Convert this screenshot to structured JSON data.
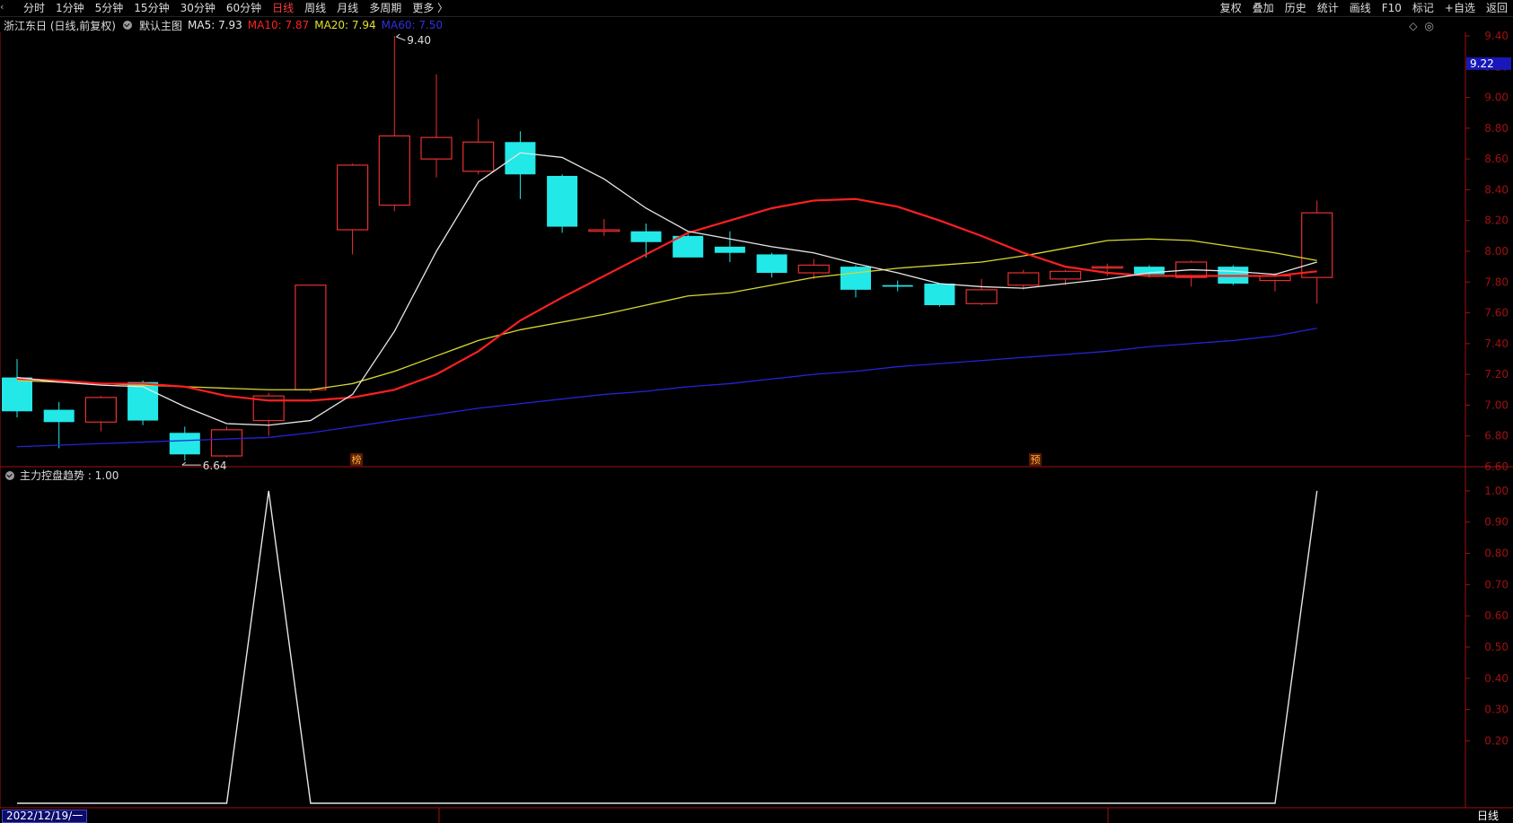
{
  "toolbar": {
    "left": [
      "分时",
      "1分钟",
      "5分钟",
      "15分钟",
      "30分钟",
      "60分钟",
      "日线",
      "周线",
      "月线",
      "多周期",
      "更多 〉"
    ],
    "active": "日线",
    "right": [
      "复权",
      "叠加",
      "历史",
      "统计",
      "画线",
      "F10",
      "标记",
      "+自选",
      "返回"
    ]
  },
  "info": {
    "stock": "浙江东日 (日线,前复权)",
    "chart_name": "默认主图",
    "ma5": "MA5: 7.93",
    "ma10": "MA10: 7.87",
    "ma20": "MA20: 7.94",
    "ma60": "MA60: 7.50"
  },
  "corner": [
    "◇",
    "◎"
  ],
  "indicator_label": "主力控盘趋势 : 1.00",
  "date_label": "2022/12/19/一",
  "period_label": "日线",
  "colors": {
    "up": "#e83030",
    "down": "#22e8e8",
    "ma5": "#e6e6e6",
    "ma10": "#ff2020",
    "ma20": "#d8d830",
    "ma60": "#2424d8",
    "axis": "#a01010",
    "bg": "#000000"
  },
  "chart_data": [
    {
      "type": "candlestick",
      "ylim": [
        6.6,
        9.4
      ],
      "yticks": [
        "9.40",
        "9.20",
        "9.00",
        "8.80",
        "8.60",
        "8.40",
        "8.20",
        "8.00",
        "7.80",
        "7.60",
        "7.40",
        "7.20",
        "7.00",
        "6.80",
        "6.60"
      ],
      "last_price": "9.22",
      "max_label": "9.40",
      "min_label": "6.64",
      "markers": [
        "榜",
        "预"
      ],
      "candles": [
        {
          "o": 7.18,
          "h": 7.3,
          "l": 6.92,
          "c": 6.96
        },
        {
          "o": 6.97,
          "h": 7.02,
          "l": 6.72,
          "c": 6.89
        },
        {
          "o": 6.89,
          "h": 7.06,
          "l": 6.83,
          "c": 7.05
        },
        {
          "o": 7.15,
          "h": 7.16,
          "l": 6.87,
          "c": 6.9
        },
        {
          "o": 6.82,
          "h": 6.86,
          "l": 6.64,
          "c": 6.68
        },
        {
          "o": 6.67,
          "h": 6.86,
          "l": 6.66,
          "c": 6.84
        },
        {
          "o": 6.9,
          "h": 7.08,
          "l": 6.8,
          "c": 7.06
        },
        {
          "o": 7.1,
          "h": 7.78,
          "l": 7.08,
          "c": 7.78
        },
        {
          "o": 8.14,
          "h": 8.57,
          "l": 7.98,
          "c": 8.56
        },
        {
          "o": 8.3,
          "h": 9.4,
          "l": 8.26,
          "c": 8.75
        },
        {
          "o": 8.6,
          "h": 9.15,
          "l": 8.48,
          "c": 8.74
        },
        {
          "o": 8.52,
          "h": 8.86,
          "l": 8.5,
          "c": 8.71
        },
        {
          "o": 8.71,
          "h": 8.78,
          "l": 8.34,
          "c": 8.5
        },
        {
          "o": 8.49,
          "h": 8.5,
          "l": 8.12,
          "c": 8.16
        },
        {
          "o": 8.13,
          "h": 8.21,
          "l": 8.1,
          "c": 8.14
        },
        {
          "o": 8.13,
          "h": 8.18,
          "l": 7.96,
          "c": 8.06
        },
        {
          "o": 8.1,
          "h": 8.12,
          "l": 7.96,
          "c": 7.96
        },
        {
          "o": 8.03,
          "h": 8.13,
          "l": 7.93,
          "c": 7.99
        },
        {
          "o": 7.98,
          "h": 7.99,
          "l": 7.83,
          "c": 7.86
        },
        {
          "o": 7.86,
          "h": 7.95,
          "l": 7.82,
          "c": 7.91
        },
        {
          "o": 7.9,
          "h": 7.91,
          "l": 7.7,
          "c": 7.75
        },
        {
          "o": 7.78,
          "h": 7.81,
          "l": 7.74,
          "c": 7.77
        },
        {
          "o": 7.79,
          "h": 7.79,
          "l": 7.64,
          "c": 7.65
        },
        {
          "o": 7.66,
          "h": 7.82,
          "l": 7.65,
          "c": 7.75
        },
        {
          "o": 7.78,
          "h": 7.88,
          "l": 7.75,
          "c": 7.86
        },
        {
          "o": 7.82,
          "h": 7.88,
          "l": 7.78,
          "c": 7.87
        },
        {
          "o": 7.9,
          "h": 7.92,
          "l": 7.84,
          "c": 7.9
        },
        {
          "o": 7.9,
          "h": 7.91,
          "l": 7.83,
          "c": 7.85
        },
        {
          "o": 7.83,
          "h": 7.94,
          "l": 7.77,
          "c": 7.93
        },
        {
          "o": 7.9,
          "h": 7.91,
          "l": 7.78,
          "c": 7.79
        },
        {
          "o": 7.81,
          "h": 7.86,
          "l": 7.74,
          "c": 7.84
        },
        {
          "o": 7.83,
          "h": 8.33,
          "l": 7.66,
          "c": 8.25
        }
      ],
      "ma5": [
        7.18,
        7.15,
        7.13,
        7.12,
        6.99,
        6.88,
        6.87,
        6.9,
        7.07,
        7.48,
        8.0,
        8.45,
        8.64,
        8.61,
        8.47,
        8.28,
        8.13,
        8.08,
        8.03,
        7.99,
        7.92,
        7.86,
        7.79,
        7.77,
        7.76,
        7.79,
        7.82,
        7.86,
        7.88,
        7.87,
        7.85,
        7.93
      ],
      "ma10": [
        7.17,
        7.16,
        7.14,
        7.14,
        7.12,
        7.06,
        7.03,
        7.03,
        7.05,
        7.1,
        7.2,
        7.35,
        7.55,
        7.7,
        7.84,
        7.98,
        8.12,
        8.2,
        8.28,
        8.33,
        8.34,
        8.29,
        8.2,
        8.1,
        7.99,
        7.9,
        7.86,
        7.84,
        7.84,
        7.84,
        7.84,
        7.87
      ],
      "ma20": [
        7.16,
        7.15,
        7.14,
        7.13,
        7.12,
        7.11,
        7.1,
        7.1,
        7.14,
        7.22,
        7.32,
        7.42,
        7.49,
        7.54,
        7.59,
        7.65,
        7.71,
        7.73,
        7.78,
        7.83,
        7.86,
        7.89,
        7.91,
        7.93,
        7.97,
        8.02,
        8.07,
        8.08,
        8.07,
        8.03,
        7.99,
        7.94
      ],
      "ma60": [
        6.73,
        6.74,
        6.75,
        6.76,
        6.77,
        6.78,
        6.79,
        6.82,
        6.86,
        6.9,
        6.94,
        6.98,
        7.01,
        7.04,
        7.07,
        7.09,
        7.12,
        7.14,
        7.17,
        7.2,
        7.22,
        7.25,
        7.27,
        7.29,
        7.31,
        7.33,
        7.35,
        7.38,
        7.4,
        7.42,
        7.45,
        7.5
      ]
    },
    {
      "type": "line",
      "name": "主力控盘趋势",
      "ylim": [
        0,
        1.04
      ],
      "yticks": [
        "1.00",
        "0.90",
        "0.80",
        "0.70",
        "0.60",
        "0.50",
        "0.40",
        "0.30",
        "0.20"
      ],
      "values": [
        0,
        0,
        0,
        0,
        0,
        0,
        1,
        0,
        0,
        0,
        0,
        0,
        0,
        0,
        0,
        0,
        0,
        0,
        0,
        0,
        0,
        0,
        0,
        0,
        0,
        0,
        0,
        0,
        0,
        0,
        0,
        1
      ]
    }
  ]
}
